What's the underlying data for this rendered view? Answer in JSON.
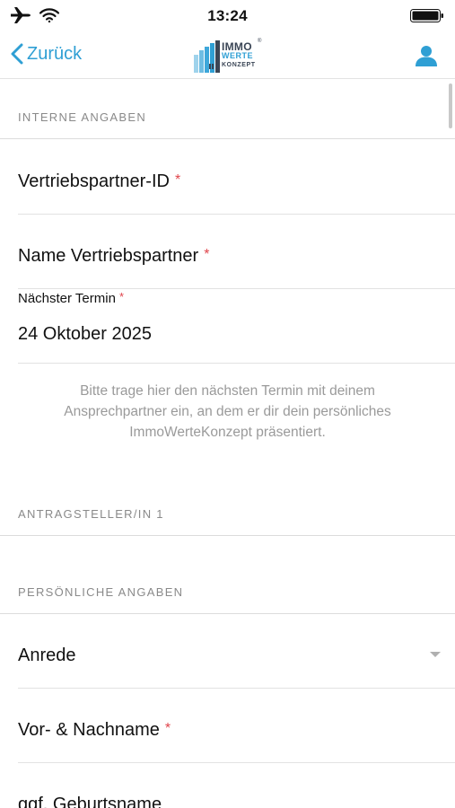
{
  "status_bar": {
    "time": "13:24",
    "icons": [
      "airplane-icon",
      "wifi-icon",
      "battery-icon"
    ]
  },
  "nav": {
    "back_label": "Zurück",
    "logo": {
      "line1": "IMMO",
      "line2": "WERTE",
      "line3": "KONZEPT",
      "mark": "®"
    },
    "colors": {
      "accent": "#2f9fd4",
      "logo_dark": "#3b4656",
      "required": "#e0454c"
    }
  },
  "sections": {
    "internal": {
      "title": "INTERNE ANGABEN"
    },
    "applicant": {
      "title": "ANTRAGSTELLER/IN 1"
    },
    "personal": {
      "title": "PERSÖNLICHE ANGABEN"
    }
  },
  "fields": {
    "partner_id": {
      "label": "Vertriebspartner-ID",
      "required_mark": "*"
    },
    "partner_name": {
      "label": "Name Vertriebspartner",
      "required_mark": "*"
    },
    "next_date": {
      "label": "Nächster Termin",
      "required_mark": "*",
      "value": "24 Oktober 2025"
    },
    "salutation": {
      "label": "Anrede"
    },
    "full_name": {
      "label": "Vor- & Nachname",
      "required_mark": "*"
    },
    "birth_name": {
      "label": "ggf. Geburtsname"
    }
  },
  "hint": {
    "line1": "Bitte trage hier den nächsten Termin mit deinem",
    "line2": "Ansprechpartner ein, an dem er dir dein persönliches",
    "line3": "ImmoWerteKonzept präsentiert."
  }
}
